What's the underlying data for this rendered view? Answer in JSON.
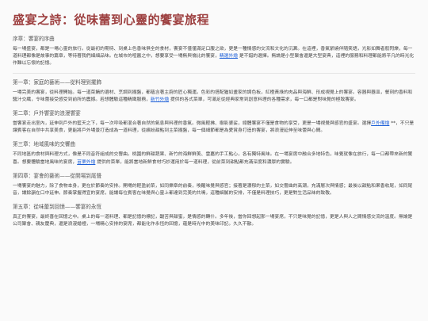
{
  "title": "盛宴之詩：從味蕾到心靈的饗宴旅程",
  "sections": [
    {
      "heading": "序章：饗宴的序曲",
      "parts": [
        "每一場盛宴，都是一場心靈的旅行。從最初的期待、到桌上色香味俱全的食材，饗宴不僅僅滿足口腹之欲，更是一種情感的交流和文化的沉澱。在這裡，香氣縈繞伴隨笑語，光影如舞者般閃爍，每一道料理都像是故事的篇章，等待著我們細細品味。在城市的喧囂之中，想要享受一場無與倫比的饗宴，",
        "精選外燴",
        " 是不錯的選擇。無論是小型聚會還是大型宴典，這裡的服務和料理都能將平凡的時光化作難以忘懷的記憶。"
      ]
    },
    {
      "heading": "第一章：家庭的藝術——從料理到擺飾",
      "parts": [
        "一場完美的饗宴，從料理開始。每一道菜餚的選材、烹調到擺盤，都蘊含著主廚的匠心獨運。色彩的搭配猶如畫家的調色板，紅橙黃綠的肉品與海鮮、形成視覺上的饗宴。容器與器皿，餐刻的香料和醬汁交織，令味蕾接受感受到前所的震撼。若想體驗這種精緻服務，",
        "新竹外燴",
        " 提供的各式菜單，可滿足從經典家常到創意料理的各種需求，每一口都是對味覺的極致饗宴。"
      ]
    },
    {
      "heading": "第二章：戶外饗宴的浪漫饗宴",
      "parts": [
        "當饗宴走出室內，延伸到戶外的藍天之下，每一次呼吸都混合著自然的氣息與料理的香氣。微風輕拂、樹影婆娑，總體饗宴不僅是食物的享受，更是一場視覺與感官的盛宴。選擇",
        "戶外備燴",
        " **，不只是讓賓客在自然中共享美食，更能將戶外場景打造成為一道料理，從繽紛甜點到主菜擺盤，每一個細節都是為愛賞身打造的饗宴，將浪漫延伸至味蕾與心間。"
      ]
    },
    {
      "heading": "第三章：地域風味的交響曲",
      "parts": [
        "不同地區的食材與料理方式，像是不同音符組成的交響曲。桃園的鮮甜蔬果、新竹的海鮮鮮美、雲嘉的手工點心，各有獨特風味。在一場宴席中融合多地特色，味覺就像在旅行，每一口都帶來新的驚喜。想要體驗當地風味的宴席，",
        "苗栗外燴",
        " 提供的菜單，能將當地新鮮食材巧妙運用於每一道料理，從前菜到甜點都充滿深度和濃厚的實驗。"
      ]
    },
    {
      "heading": "第四章：宴會的藝術——從開場到尾聲",
      "parts": [
        "一場饗宴的魅力，除了食物本身，更在於節奏的安排。開場的輕盈前菜，如同樂章的前奏，喚醒味覺與感官；接著是濃郁的主菜，如交響曲的高潮，充滿層次與情感；最後以甜點和果香收尾，如同尾音，讓餘韻在口中延伸。節奏掌握得宜的宴席，能讓每位賓客在味覺與心靈上都達到完美的共鳴，這種細膩的安排，不僅是料理技巧，更是對生活品味的致敬。"
      ]
    },
    {
      "heading": "第五章：從味蕾到回憶——饗宴的永恆",
      "parts": [
        "真正的饗宴，最終喜在回憶之中。桌上的每一道料理、都是記憶的標記，酸苦與甜蜜，是情感的轉什。多年後，當你回想起那一場宴席，不只是味覺的記憶，更是人與人之間情感交流的溫度。無論是公司聚會、親友慶典，還是浪漫婚禮，一場精心安排的宴席，都能化作永恆的回憶，蘊是時光中的美味印記。久久不散。"
      ]
    }
  ]
}
